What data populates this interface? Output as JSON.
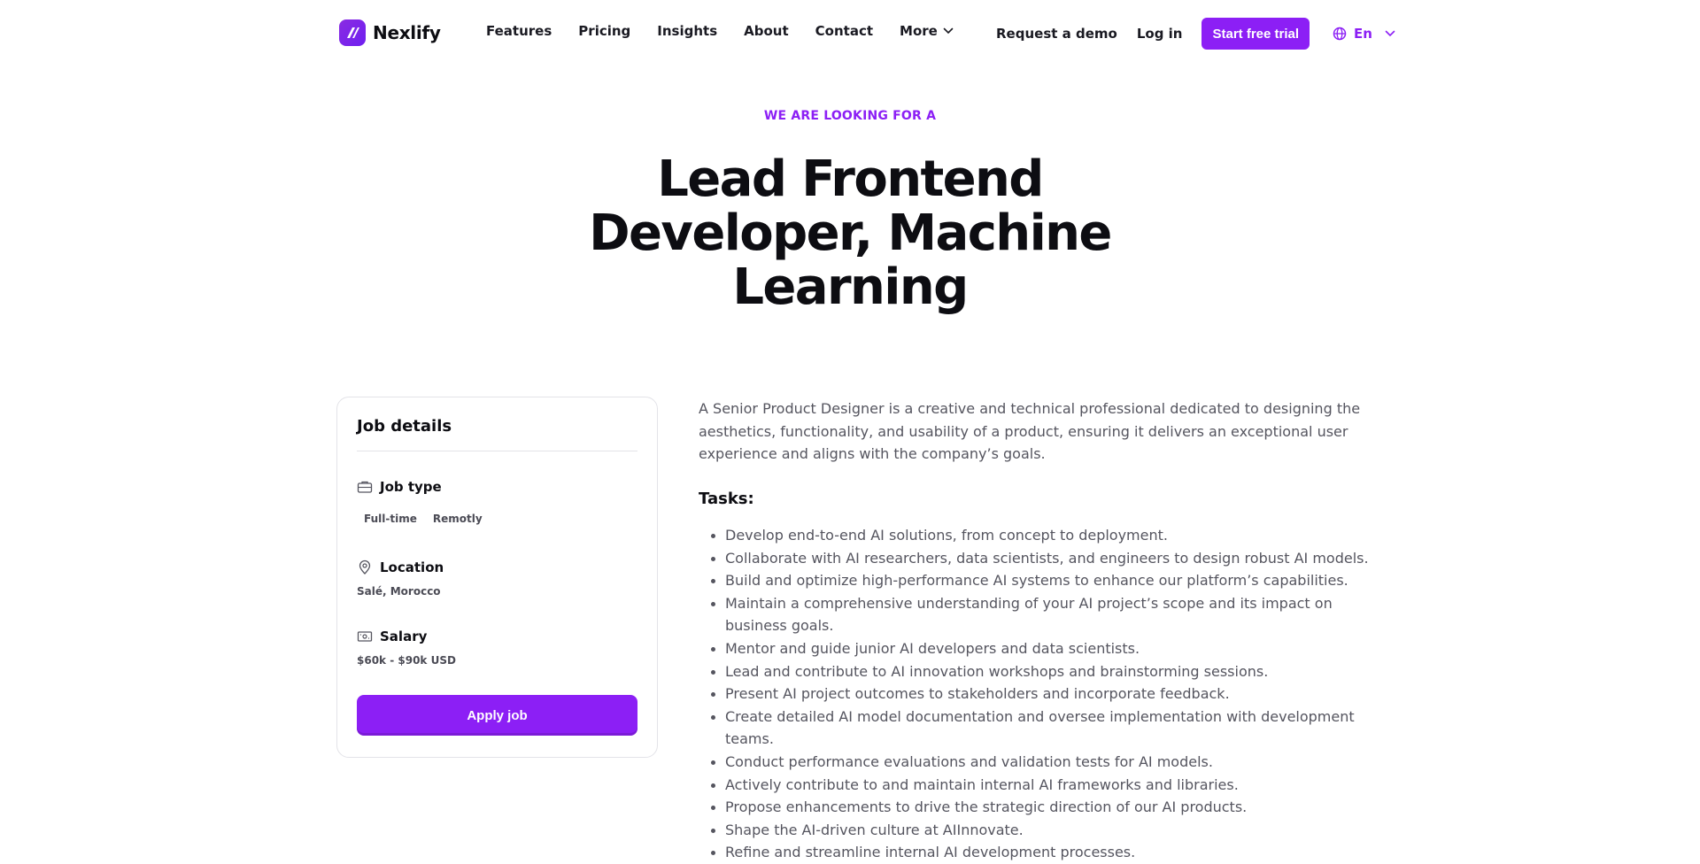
{
  "brand": {
    "name": "Nexlify",
    "accent": "#8c1ff5"
  },
  "nav": {
    "items": [
      "Features",
      "Pricing",
      "Insights",
      "About",
      "Contact"
    ],
    "more_label": "More"
  },
  "actions": {
    "demo": "Request a demo",
    "login": "Log in",
    "trial": "Start free trial",
    "language": "En"
  },
  "hero": {
    "eyebrow": "WE ARE LOOKING FOR A",
    "title": "Lead Frontend Developer, Machine Learning"
  },
  "job_details": {
    "title": "Job details",
    "job_type_label": "Job type",
    "job_types": [
      "Full-time",
      "Remotly"
    ],
    "location_label": "Location",
    "location_value": "Salé, Morocco",
    "salary_label": "Salary",
    "salary_value": "$60k - $90k USD",
    "apply_label": "Apply job"
  },
  "description": "A Senior Product Designer is a creative and technical professional dedicated to designing the aesthetics, functionality, and usability of a product, ensuring it delivers an exceptional user experience and aligns with the company’s goals.",
  "tasks_heading": "Tasks:",
  "tasks": [
    "Develop end-to-end AI solutions, from concept to deployment.",
    "Collaborate with AI researchers, data scientists, and engineers to design robust AI models.",
    "Build and optimize high-performance AI systems to enhance our platform’s capabilities.",
    "Maintain a comprehensive understanding of your AI project’s scope and its impact on business goals.",
    "Mentor and guide junior AI developers and data scientists.",
    "Lead and contribute to AI innovation workshops and brainstorming sessions.",
    "Present AI project outcomes to stakeholders and incorporate feedback.",
    "Create detailed AI model documentation and oversee implementation with development teams.",
    "Conduct performance evaluations and validation tests for AI models.",
    "Actively contribute to and maintain internal AI frameworks and libraries.",
    "Propose enhancements to drive the strategic direction of our AI products.",
    "Shape the AI-driven culture at AIInnovate.",
    "Refine and streamline internal AI development processes."
  ]
}
